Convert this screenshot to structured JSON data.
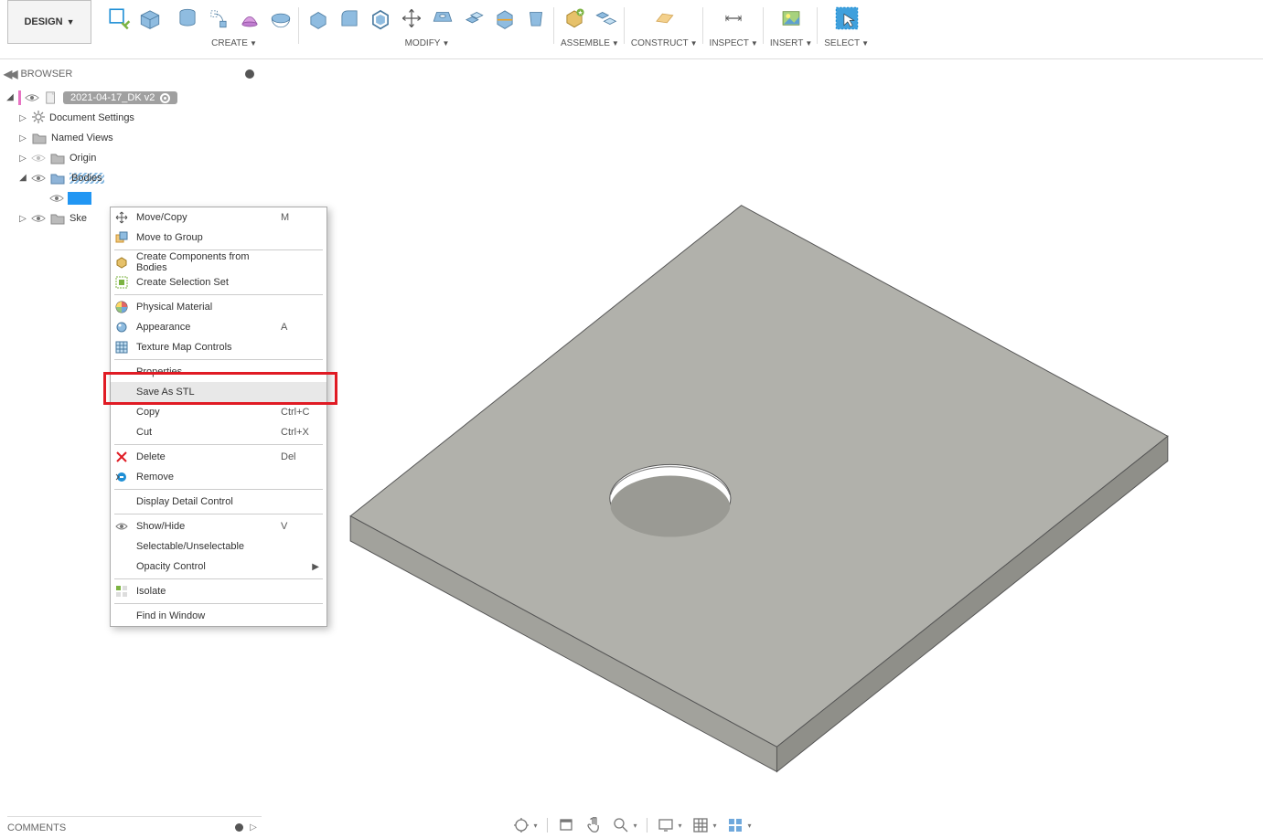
{
  "ribbon": {
    "designBtn": "DESIGN",
    "groups": {
      "create": "CREATE",
      "modify": "MODIFY",
      "assemble": "ASSEMBLE",
      "construct": "CONSTRUCT",
      "inspect": "INSPECT",
      "insert": "INSERT",
      "select": "SELECT"
    }
  },
  "browser": {
    "title": "BROWSER",
    "file": "2021-04-17_DK v2",
    "nodes": {
      "docSettings": "Document Settings",
      "namedViews": "Named Views",
      "origin": "Origin",
      "bodies": "Bodies",
      "sketches": "Ske"
    }
  },
  "contextMenu": {
    "moveCopy": {
      "label": "Move/Copy",
      "short": "M"
    },
    "moveToGroup": "Move to Group",
    "createComponents": "Create Components from Bodies",
    "createSelection": "Create Selection Set",
    "physicalMaterial": "Physical Material",
    "appearance": {
      "label": "Appearance",
      "short": "A"
    },
    "textureMap": "Texture Map Controls",
    "properties": "Properties",
    "saveStl": "Save As STL",
    "copy": {
      "label": "Copy",
      "short": "Ctrl+C"
    },
    "cut": {
      "label": "Cut",
      "short": "Ctrl+X"
    },
    "delete": {
      "label": "Delete",
      "short": "Del"
    },
    "remove": "Remove",
    "displayDetail": "Display Detail Control",
    "showHide": {
      "label": "Show/Hide",
      "short": "V"
    },
    "selectable": "Selectable/Unselectable",
    "opacity": "Opacity Control",
    "isolate": "Isolate",
    "findWindow": "Find in Window"
  },
  "comments": "COMMENTS"
}
